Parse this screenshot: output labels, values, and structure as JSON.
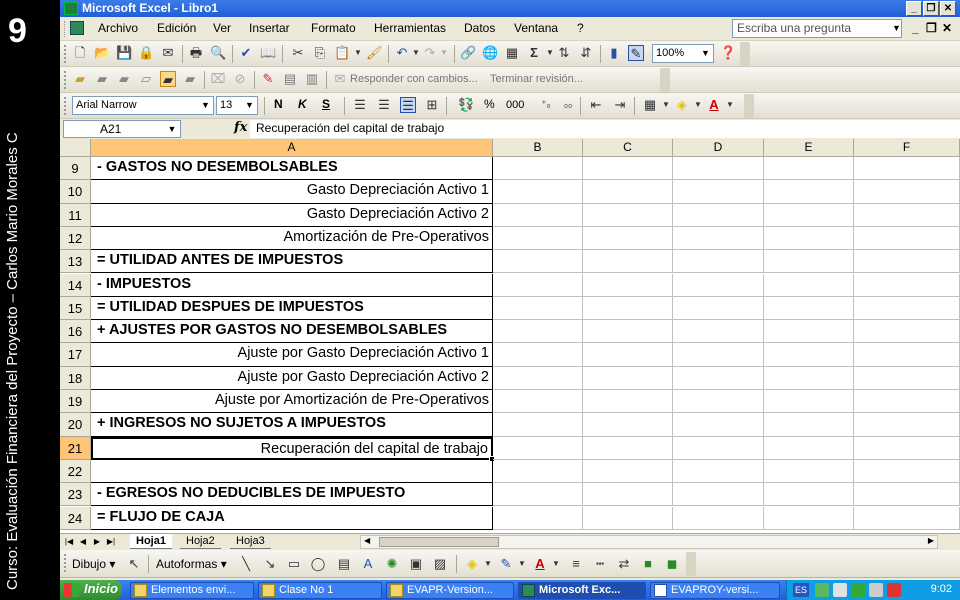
{
  "slide": {
    "number": "9",
    "caption": "Curso: Evaluación Financiera del Proyecto – Carlos Mario Morales C"
  },
  "window": {
    "title": "Microsoft Excel - Libro1",
    "buttons": [
      "_",
      "❐",
      "✕"
    ]
  },
  "menu": {
    "items": [
      "Archivo",
      "Edición",
      "Ver",
      "Insertar",
      "Formato",
      "Herramientas",
      "Datos",
      "Ventana",
      "?"
    ],
    "help_placeholder": "Escriba una pregunta",
    "mdi_buttons": [
      "_",
      "❐",
      "✕"
    ]
  },
  "toolbar_standard": {
    "zoom": "100%",
    "sigma": "Σ"
  },
  "toolbar_review": {
    "reply_label": "Responder con cambios...",
    "end_review_label": "Terminar revisión..."
  },
  "toolbar_format": {
    "font": "Arial Narrow",
    "size": "13",
    "bold": "N",
    "italic": "K",
    "underline": "S",
    "percent": "%",
    "thousands": "000"
  },
  "formula_bar": {
    "name_box": "A21",
    "fx": "fx",
    "content": "Recuperación del capital de trabajo"
  },
  "columns": [
    "A",
    "B",
    "C",
    "D",
    "E",
    "F"
  ],
  "rows": [
    {
      "num": "9",
      "text": "- GASTOS NO DESEMBOLSABLES",
      "style": "bold"
    },
    {
      "num": "10",
      "text": "Gasto Depreciación Activo 1",
      "style": "right"
    },
    {
      "num": "11",
      "text": "Gasto Depreciación Activo 2",
      "style": "right"
    },
    {
      "num": "12",
      "text": "Amortización de Pre-Operativos",
      "style": "right"
    },
    {
      "num": "13",
      "text": "= UTILIDAD ANTES DE IMPUESTOS",
      "style": "bold"
    },
    {
      "num": "14",
      "text": "- IMPUESTOS",
      "style": "bold"
    },
    {
      "num": "15",
      "text": "= UTILIDAD DESPUES DE IMPUESTOS",
      "style": "bold"
    },
    {
      "num": "16",
      "text": "+ AJUSTES POR GASTOS NO DESEMBOLSABLES",
      "style": "bold"
    },
    {
      "num": "17",
      "text": "Ajuste por Gasto Depreciación Activo 1",
      "style": "right"
    },
    {
      "num": "18",
      "text": "Ajuste por Gasto Depreciación Activo 2",
      "style": "right"
    },
    {
      "num": "19",
      "text": "Ajuste por Amortización de Pre-Operativos",
      "style": "right"
    },
    {
      "num": "20",
      "text": "+ INGRESOS NO SUJETOS A IMPUESTOS",
      "style": "bold"
    },
    {
      "num": "21",
      "text": "Recuperación del capital de trabajo",
      "style": "right"
    },
    {
      "num": "22",
      "text": "",
      "style": "right"
    },
    {
      "num": "23",
      "text": "- EGRESOS NO DEDUCIBLES DE IMPUESTO",
      "style": "bold"
    },
    {
      "num": "24",
      "text": "= FLUJO DE CAJA",
      "style": "bold"
    }
  ],
  "sheets": [
    "Hoja1",
    "Hoja2",
    "Hoja3"
  ],
  "drawing_toolbar": {
    "draw_label": "Dibujo ▾",
    "autoshapes_label": "Autoformas ▾"
  },
  "taskbar": {
    "start": "Inicio",
    "tasks": [
      {
        "label": "Elementos envi...",
        "active": false
      },
      {
        "label": "Clase No 1",
        "active": false
      },
      {
        "label": "EVAPR-Version...",
        "active": false
      },
      {
        "label": "Microsoft Exc...",
        "active": true
      },
      {
        "label": "EVAPROY-versi...",
        "active": false
      }
    ],
    "lang": "ES",
    "clock": "9:02"
  }
}
